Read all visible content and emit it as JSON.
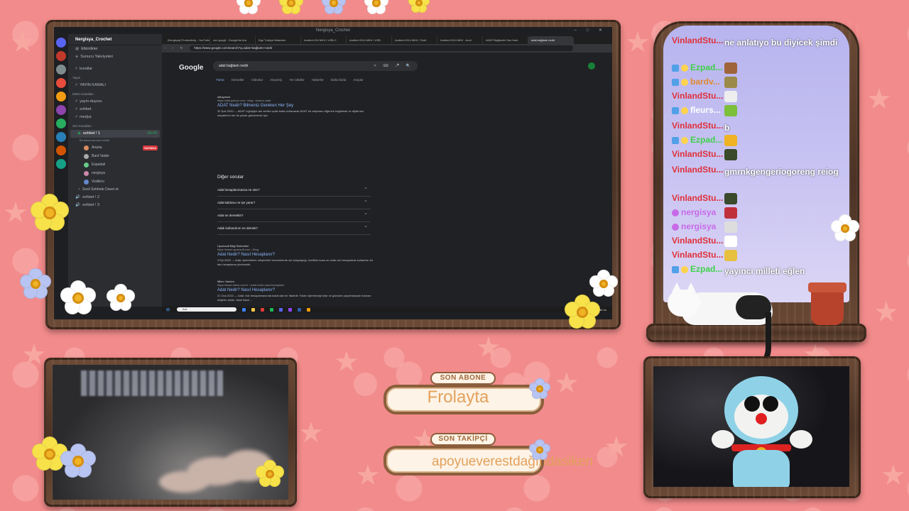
{
  "screen": {
    "window_title": "Nergisya_Crochet",
    "discord": {
      "server_name": "Nergisya_Crochet",
      "channels_top": [
        "Etkinlikler",
        "Sunucu Takviyeleri"
      ],
      "rules_channel": "kurallar",
      "category_yayin": "Yayın",
      "yayin_channel": "YAYIN KANALI",
      "category_metin": "Metin Kanalları",
      "text_channels": [
        "yayin-duyuru",
        "sohbet",
        "medya"
      ],
      "category_ses": "Ses Kanalları",
      "voice_channel": "sohbet ! 1",
      "voice_time": "34:40",
      "voice_status": "Bu kanal durumu belirle",
      "live_badge": "YAYINDA",
      "voice_users": [
        "Anana",
        "Bard Vader",
        "Espadali",
        "nergisya",
        "Vodkino"
      ],
      "invite_text": "Sesli Sohbete Davet et",
      "voice_channels_more": [
        "sohbet ! 2",
        "sohbet ! 3"
      ],
      "user_label": "FGA"
    },
    "browser": {
      "tabs": [
        "(Nergisya) Productivity - YouTube",
        "ceo googli - Google'de Ara",
        "Ege Turkiye Malzeme",
        "Audient iD4 MKII / USB-C",
        "Audient iD14 MKII / USB",
        "Audient iD14 MKII / Gold",
        "Audient iD14 MKII - Audi",
        "ADAT Bağlantılı Ses Kartı",
        "adat bağlantı nedir"
      ],
      "url": "https://www.google.com/search?q=adat+bağlantı+nedir",
      "google_logo": "Google",
      "query": "adat bağlantı nedir",
      "filters": [
        "Tümü",
        "Görseller",
        "Videolar",
        "Alışveriş",
        "Yer ödüller",
        "Haberler",
        "Daha fazla",
        "Araçlar"
      ],
      "result1": {
        "site": "stduyanıoi",
        "url": "https://stduyanıoi.com › blog › what-is-adat",
        "title": "ADAT Nedir? Bilmeniz Gereken Her Şey",
        "snippet": "30 Şub 2020 — ADAT Lightpipe adı verilen optik kablo kullanarak ADAT bir ekipmanı diğerine bağlamak ve dijital ses sinyallerini her iki yönde göndermek için."
      },
      "paa_header": "Diğer sorular",
      "paa": [
        "Adat hesaplanmazsa ne olur?",
        "Adat kablosu ne işe yarar?",
        "Adat ne demektir?",
        "Adalı kullandırım ne demek?"
      ],
      "result2": {
        "site": "Uyumsoft Bilgi Sistemleri",
        "url": "https://www.uyumsoft.com › Blog",
        "title": "Adat Nedir? Nasıl Hesaplanır?",
        "snippet": "3 Eyl 2020 — Adat, işletmelerin müşterileri vereceklerde sık karşılaştığı, özellikle kasa ve ortak cari hesaplarda kullanılan bir faiz hesaplama yöntemidir."
      },
      "result3": {
        "site": "Mikro Yazılım",
        "url": "https://www.mikro.com.tr › adat-nedir-nasil-hesaplanir",
        "title": "Adat Nedir? Nasıl Hesaplanır?",
        "snippet": "21 Oca 2022 — Adat, faiz hesaplamasında kullanılan bir ifadedir. Faizin işlemeceği tutar ve günsüre çarpılmasıyla bulunan değerin adıdır. Adat Nasıl ..."
      },
      "result4": {
        "site": "itibasi.com",
        "url": "https://itibasi.com › blog"
      }
    },
    "taskbar": {
      "search": "Ara",
      "weather": "24°C  Parçalı bu"
    }
  },
  "chat": [
    {
      "user": "VinlandStu...",
      "color": "#e0303a",
      "msg": "ne anlatıyo bu diyicek şimdi"
    },
    {
      "user": "Ezpad...",
      "color": "#3fd14a",
      "badges": true,
      "emote": "#a0643a"
    },
    {
      "user": "bardv...",
      "color": "#e08a30",
      "badges": true,
      "emote": "#9b8a4a"
    },
    {
      "user": "VinlandStu...",
      "color": "#e0303a",
      "emote": "#eeeeee"
    },
    {
      "user": "fleurs...",
      "color": "#ffffff",
      "badges": true,
      "emote": "#7cbf3a"
    },
    {
      "user": "VinlandStu...",
      "color": "#e0303a",
      "msg": "b"
    },
    {
      "user": "Ezpad...",
      "color": "#3fd14a",
      "badges": true,
      "emote": "#f0b323"
    },
    {
      "user": "VinlandStu...",
      "color": "#e0303a",
      "emote": "#3a4a2a"
    },
    {
      "user": "VinlandStu...",
      "color": "#e0303a",
      "msg": "gmrnkgengeriogoreng reiog"
    },
    {
      "user": "VinlandStu...",
      "color": "#e0303a",
      "emote": "#3a4a2a"
    },
    {
      "user": "nergisya",
      "color": "#c86ae8",
      "prefix": true,
      "emote": "#c0303a"
    },
    {
      "user": "nergisya",
      "color": "#c86ae8",
      "prefix": true,
      "emote": "#dddddd"
    },
    {
      "user": "VinlandStu...",
      "color": "#e0303a",
      "emote": "#ffffff"
    },
    {
      "user": "VinlandStu...",
      "color": "#e0303a",
      "emote": "#e8c040"
    },
    {
      "user": "Ezpad...",
      "color": "#3fd14a",
      "badges": true,
      "msg": "yayıncı milleti eğlen"
    }
  ],
  "son_abone": {
    "label": "SON ABONE",
    "name": "Frolayta"
  },
  "son_takipci": {
    "label": "SON TAKİPÇİ",
    "name": "apoyueverestdağındasiken"
  },
  "colors": {
    "background": "#f28b8b",
    "wood": "#5a3c2a",
    "chat_bg": "#c4c0f0",
    "plaque_text": "#e3a15c"
  }
}
